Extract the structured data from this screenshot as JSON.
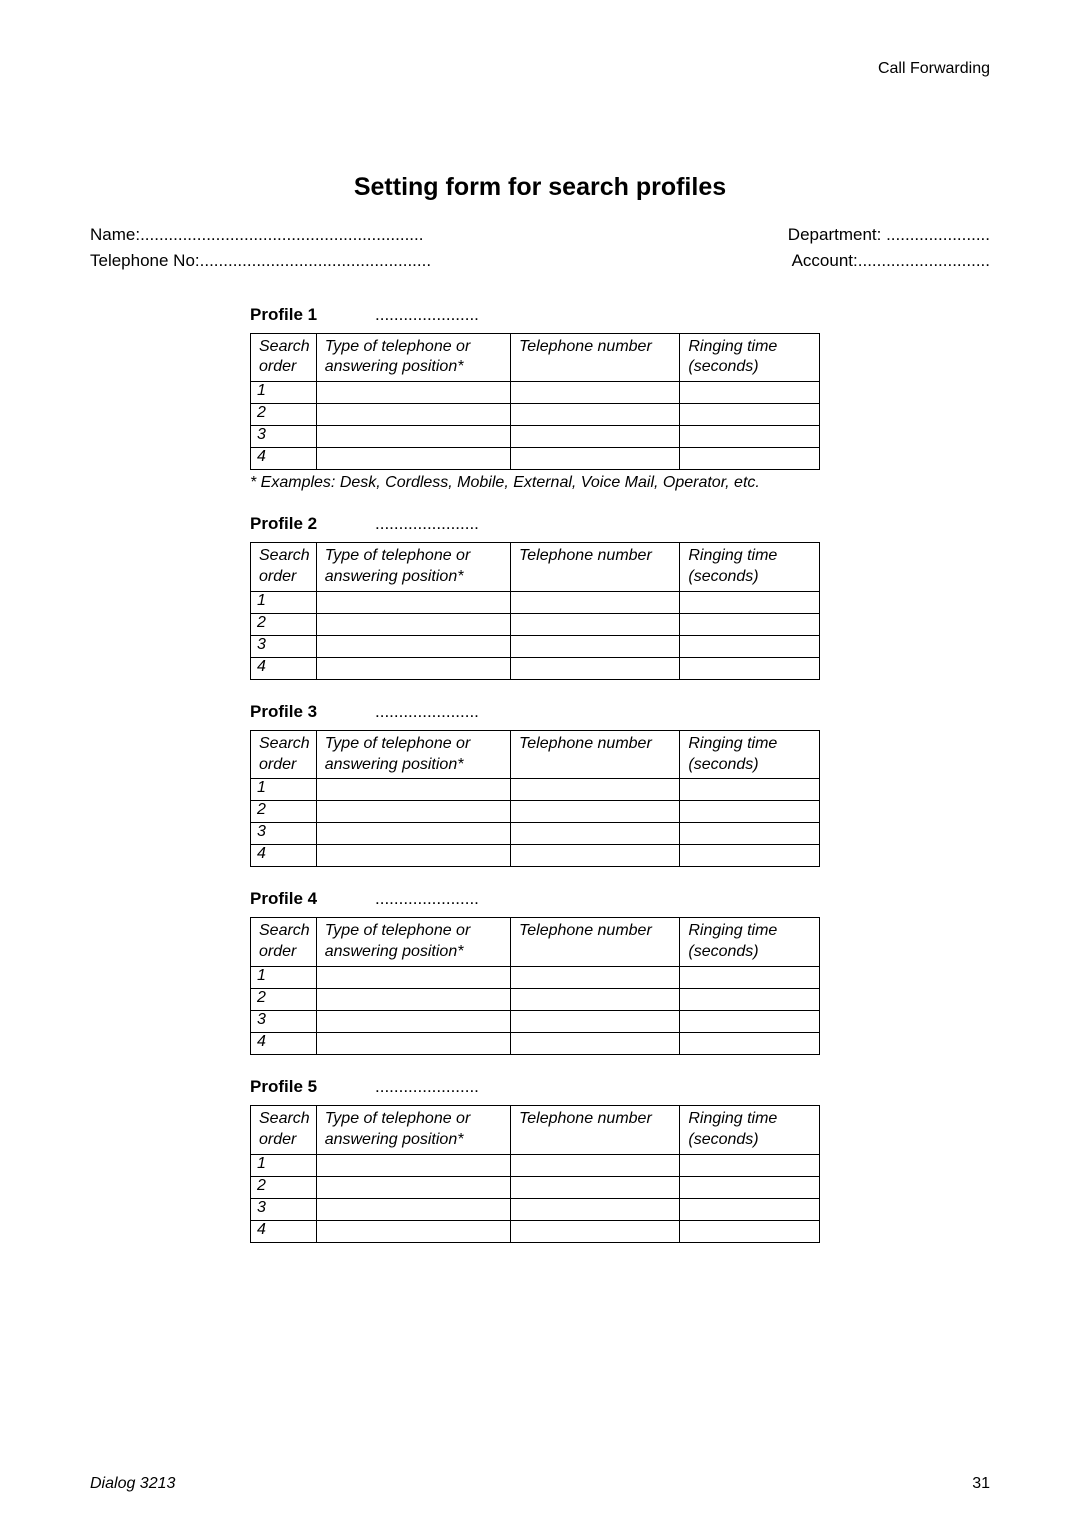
{
  "header": "Call Forwarding",
  "title": "Setting form for search profiles",
  "meta": {
    "name_label": "Name:",
    "name_dots": "............................................................",
    "tel_label": "Telephone No:",
    "tel_dots": ".................................................",
    "dept_label": "Department:",
    "dept_dots": "......................",
    "acct_label": "Account:",
    "acct_dots": "............................"
  },
  "table_headers": {
    "col1": "Search order",
    "col2": "Type of telephone or answering position*",
    "col3": "Telephone number",
    "col4": "Ringing time (seconds)"
  },
  "row_numbers": [
    "1",
    "2",
    "3",
    "4"
  ],
  "profiles": [
    {
      "label": "Profile 1",
      "dots": "......................",
      "footnote": "* Examples: Desk, Cordless, Mobile, External, Voice Mail, Operator, etc."
    },
    {
      "label": "Profile 2",
      "dots": "......................",
      "footnote": ""
    },
    {
      "label": "Profile 3",
      "dots": "......................",
      "footnote": ""
    },
    {
      "label": "Profile 4",
      "dots": "......................",
      "footnote": ""
    },
    {
      "label": "Profile 5",
      "dots": "......................",
      "footnote": ""
    }
  ],
  "footer": {
    "left": "Dialog 3213",
    "right": "31"
  }
}
